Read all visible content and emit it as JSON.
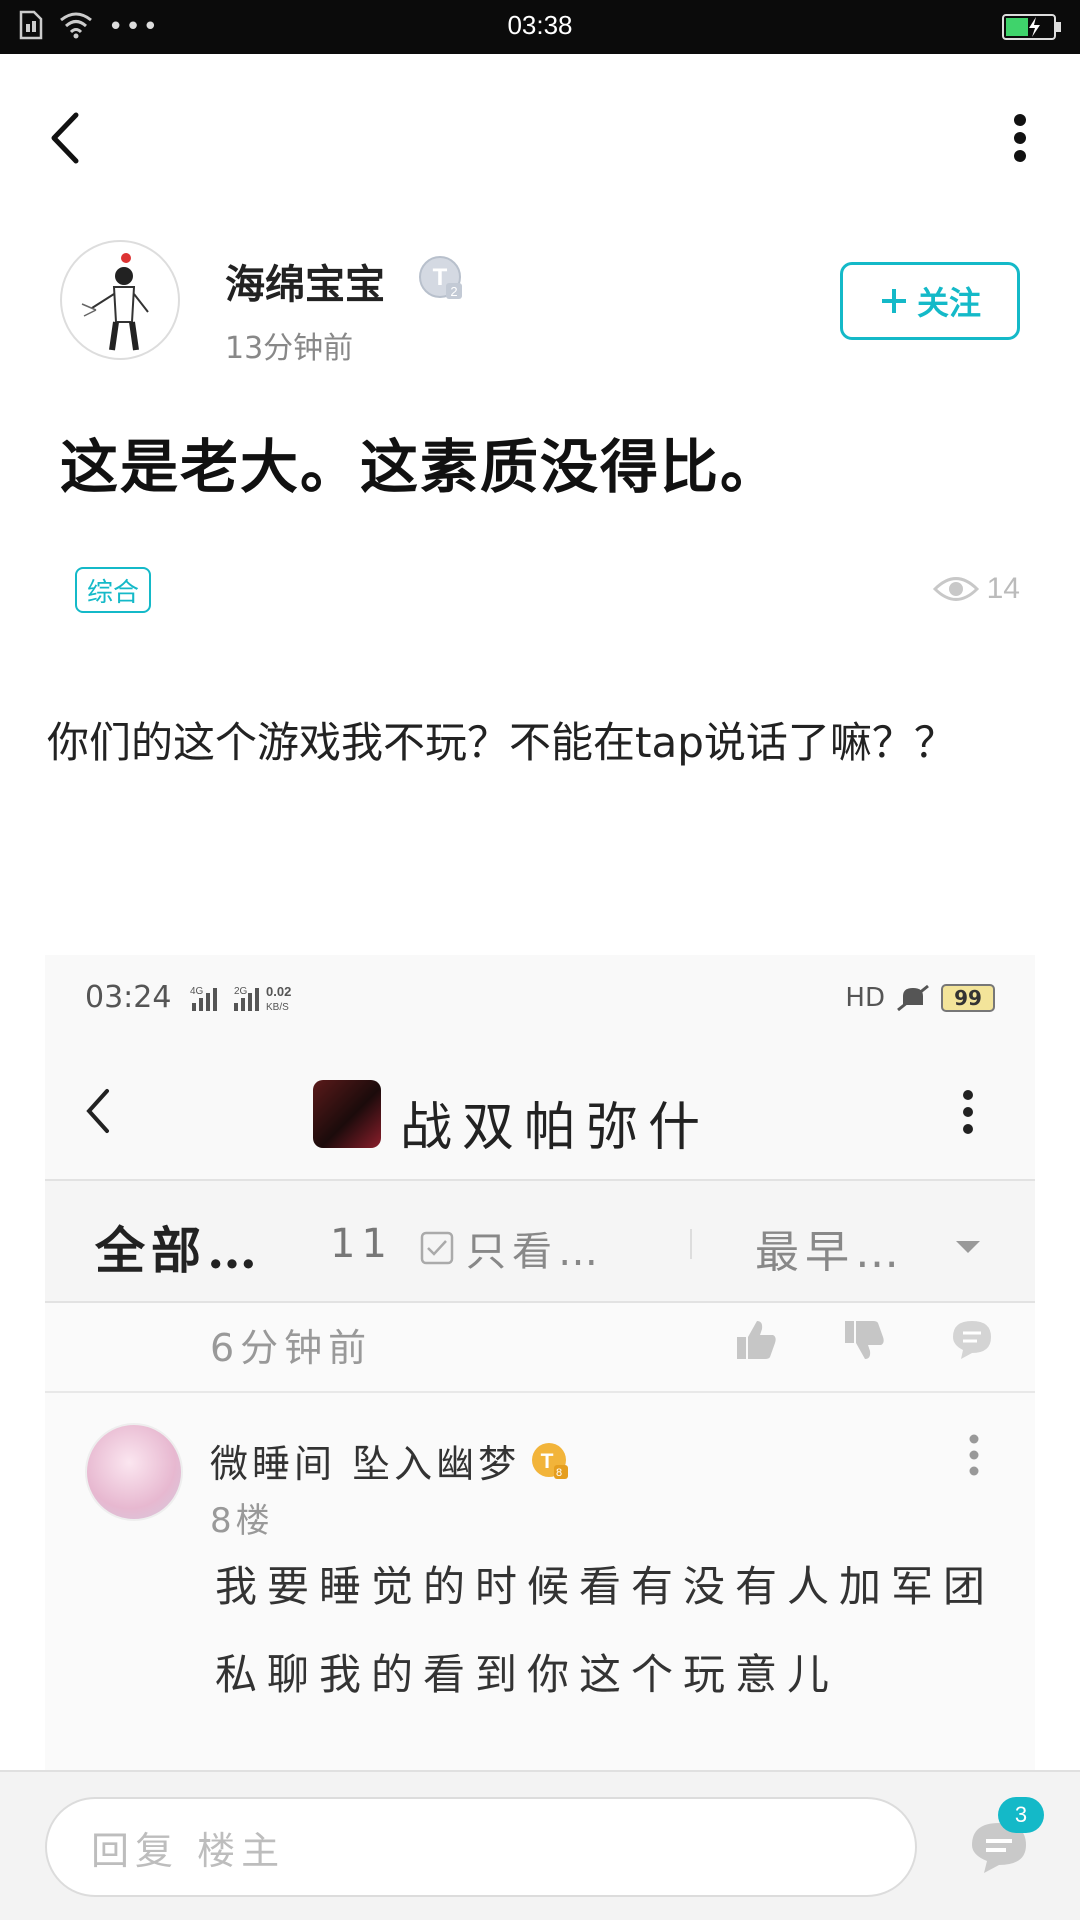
{
  "status_bar": {
    "time": "03:38"
  },
  "author": {
    "name": "海绵宝宝",
    "level": "2",
    "time_ago": "13分钟前",
    "follow_label": "关注"
  },
  "post": {
    "title": "这是老大。这素质没得比。",
    "tag": "综合",
    "views": "14",
    "body": "你们的这个游戏我不玩？不能在tap说话了嘛？？"
  },
  "embedded_screenshot": {
    "status_time": "03:24",
    "net_speed": "0.02",
    "net_unit": "KB/S",
    "hd_label": "HD",
    "battery": "99",
    "game_title": "战双帕弥什",
    "filter_all": "全部…",
    "filter_count": "11",
    "filter_only": "只看…",
    "filter_sort": "最早…",
    "meta_time": "6分钟前",
    "reply": {
      "user": "微睡间 坠入幽梦",
      "level": "8",
      "floor": "8楼",
      "text": "我要睡觉的时候看有没有人加军团私聊我的看到你这个玩意儿"
    }
  },
  "bottom_bar": {
    "reply_placeholder": "回复  楼主",
    "comment_count": "3"
  },
  "colors": {
    "accent": "#14b9c8"
  }
}
